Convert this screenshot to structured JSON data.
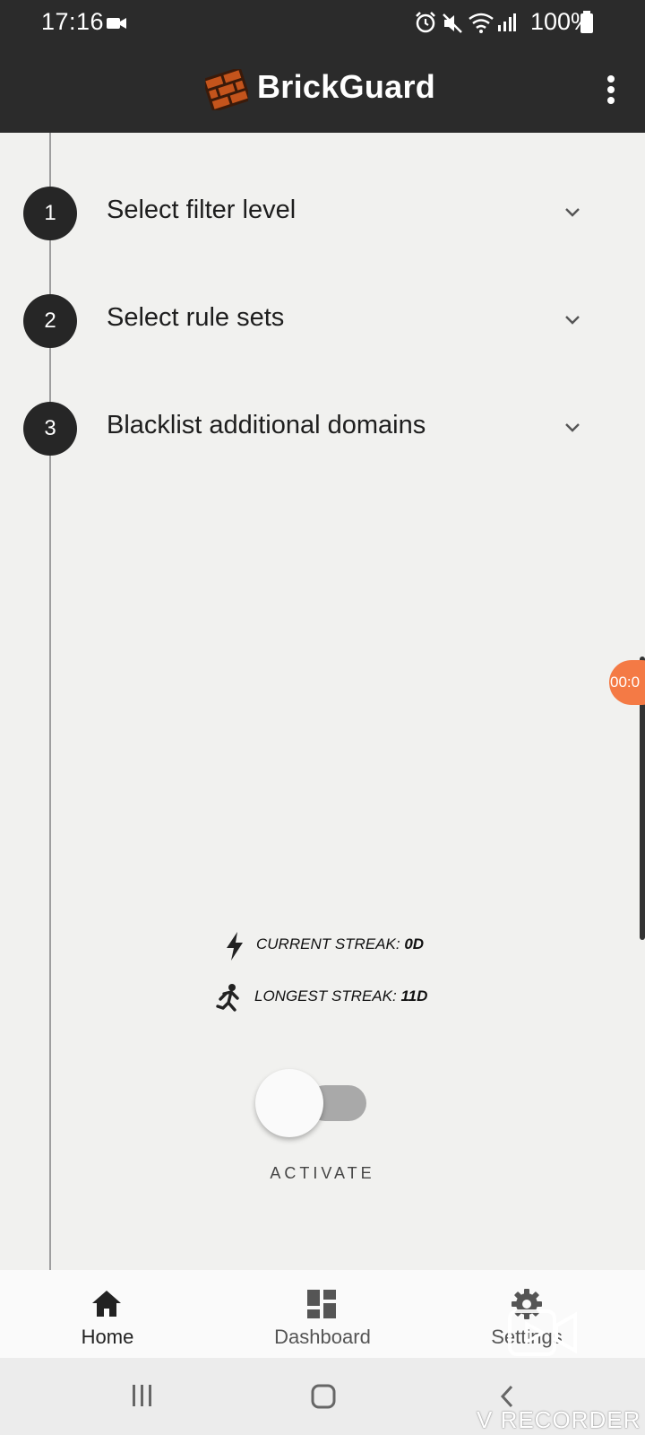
{
  "status_bar": {
    "time": "17:16",
    "battery_percent": "100%",
    "icons": [
      "video-camera-icon",
      "alarm-icon",
      "mute-icon",
      "wifi-icon",
      "signal-icon",
      "battery-icon"
    ]
  },
  "app_bar": {
    "brand_name": "BrickGuard",
    "logo_icon": "brick-wall-icon",
    "menu_icon": "more-vert-icon"
  },
  "steps": [
    {
      "number": "1",
      "label": "Select filter level"
    },
    {
      "number": "2",
      "label": "Select rule sets"
    },
    {
      "number": "3",
      "label": "Blacklist additional domains"
    }
  ],
  "streaks": {
    "current_label": "CURRENT STREAK:",
    "current_value": "0D",
    "longest_label": "LONGEST STREAK:",
    "longest_value": "11D"
  },
  "activate": {
    "label": "ACTIVATE",
    "on": false
  },
  "recorder_bubble": {
    "text": "00:0"
  },
  "bottom_nav": {
    "items": [
      {
        "label": "Home",
        "icon": "home-icon",
        "active": true
      },
      {
        "label": "Dashboard",
        "icon": "dashboard-icon",
        "active": false
      },
      {
        "label": "Settings",
        "icon": "gear-icon",
        "active": false
      }
    ]
  },
  "watermark": {
    "text": "V RECORDER"
  },
  "colors": {
    "app_bar": "#2b2b2b",
    "background": "#f1f1ef",
    "brick": "#c4541c",
    "recorder": "#f47a45"
  }
}
